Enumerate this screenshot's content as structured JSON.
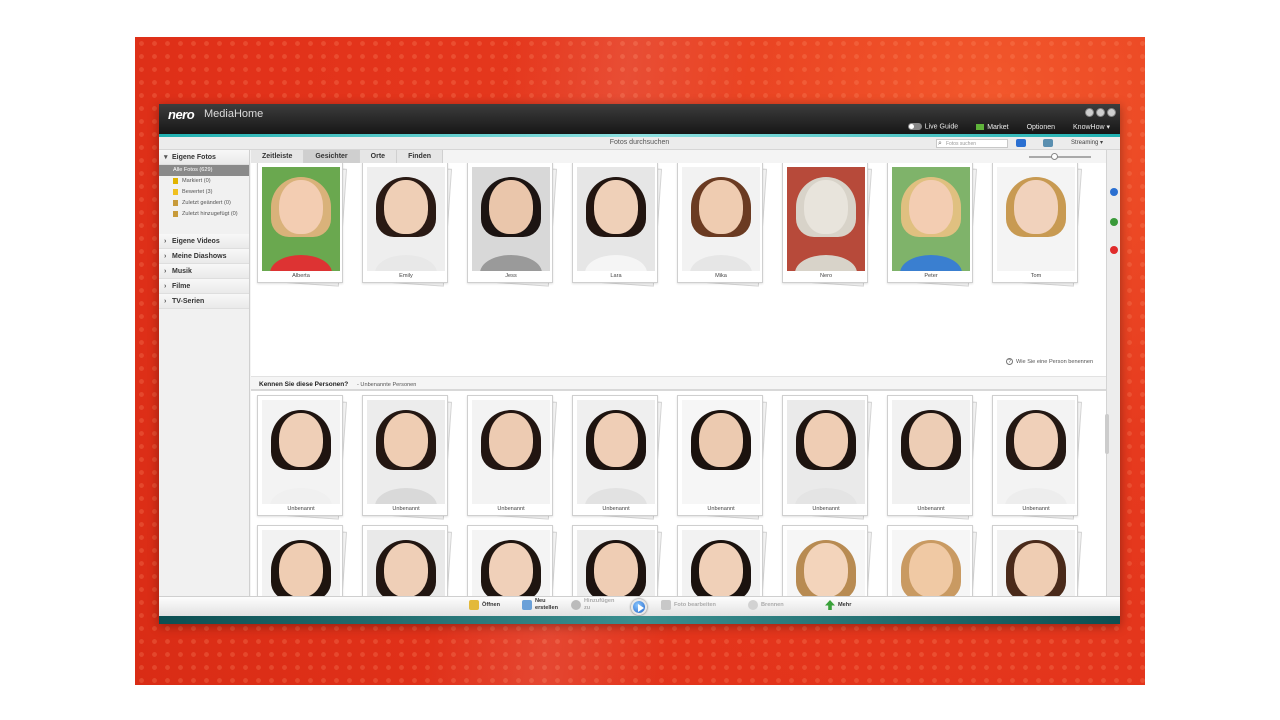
{
  "app": {
    "logo": "nero",
    "name": "MediaHome"
  },
  "topmenu": {
    "live_guide": "Live Guide",
    "market": "Market",
    "options": "Optionen",
    "knowhow": "KnowHow ▾"
  },
  "header": {
    "title": "Fotos durchsuchen",
    "search_placeholder": "Fotos suchen",
    "streaming": "Streaming ▾"
  },
  "sidebar": {
    "own_photos": "Eigene Fotos",
    "photo_items": [
      "Alle Fotos (629)",
      "Markiert (0)",
      "Bewertet (3)",
      "Zuletzt geändert (0)",
      "Zuletzt hinzugefügt (0)"
    ],
    "sections": [
      "Eigene Videos",
      "Meine Diashows",
      "Musik",
      "Filme",
      "TV-Serien"
    ]
  },
  "tabs": [
    "Zeitleiste",
    "Gesichter",
    "Orte",
    "Finden"
  ],
  "known_people": [
    "Alberta",
    "Emily",
    "Jess",
    "Lara",
    "Mika",
    "Nero",
    "Peter",
    "Tom"
  ],
  "howto": "Wie Sie eine Person benennen",
  "question": {
    "title": "Kennen Sie diese Personen?",
    "subtitle": "- Unbenannte Personen"
  },
  "unknown_label": "Unbenannt",
  "toolbar": {
    "open": "Öffnen",
    "new_create_1": "Neu",
    "new_create_2": "erstellen",
    "add_1": "Hinzufügen",
    "add_2": "zu",
    "edit_photo": "Foto bearbeiten",
    "burn": "Brennen",
    "more": "Mehr"
  },
  "colors": {
    "accent_teal": "#1fb0b0",
    "background_red": "#e2321a"
  }
}
